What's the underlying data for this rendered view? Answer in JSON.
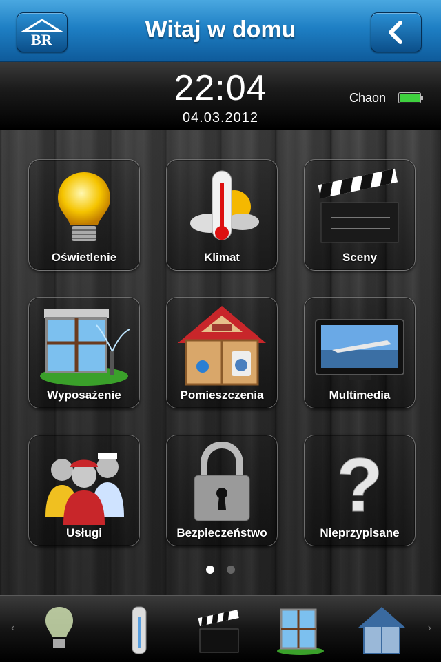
{
  "header": {
    "title": "Witaj w domu",
    "logo_icon": "house-br-logo-icon",
    "back_icon": "chevron-left-icon"
  },
  "status": {
    "time": "22:04",
    "date": "04.03.2012",
    "device_name": "Chaon",
    "battery_icon": "battery-full-icon",
    "battery_color": "#3fd23f"
  },
  "tiles": [
    {
      "label": "Oświetlenie",
      "icon": "light-bulb-icon"
    },
    {
      "label": "Klimat",
      "icon": "thermometer-icon"
    },
    {
      "label": "Sceny",
      "icon": "clapperboard-icon"
    },
    {
      "label": "Wyposażenie",
      "icon": "window-sprinkler-icon"
    },
    {
      "label": "Pomieszczenia",
      "icon": "house-rooms-icon"
    },
    {
      "label": "Multimedia",
      "icon": "tv-icon"
    },
    {
      "label": "Usługi",
      "icon": "service-people-icon"
    },
    {
      "label": "Bezpieczeństwo",
      "icon": "padlock-icon"
    },
    {
      "label": "Nieprzypisane",
      "icon": "question-mark-icon"
    }
  ],
  "pagination": {
    "pages": 2,
    "current": 1
  },
  "dock": {
    "items": [
      "light-bulb-icon",
      "thermometer-icon",
      "clapperboard-icon",
      "window-sprinkler-icon",
      "house-rooms-icon"
    ],
    "left_arrow": "‹",
    "right_arrow": "›"
  },
  "colors": {
    "header_blue": "#1e7fc4",
    "accent_red": "#c8262a"
  }
}
